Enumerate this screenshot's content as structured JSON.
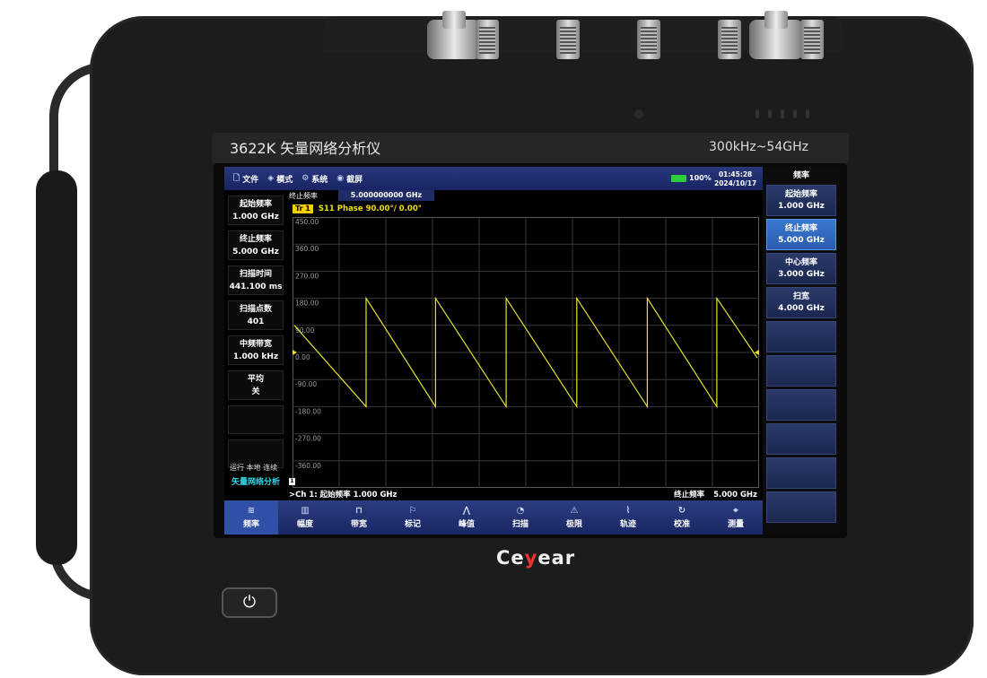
{
  "device": {
    "model": "3622K 矢量网络分析仪",
    "range": "300kHz~54GHz",
    "brand_pre": "Ce",
    "brand_slash": "y",
    "brand_post": "ear",
    "power_icon": "power-icon"
  },
  "topbar": {
    "items": [
      {
        "icon": "file-icon",
        "label": "文件"
      },
      {
        "icon": "mode-icon",
        "label": "模式"
      },
      {
        "icon": "gear-icon",
        "label": "系统"
      },
      {
        "icon": "camera-icon",
        "label": "截屏"
      }
    ],
    "battery": "100%",
    "time": "01:45:28",
    "date": "2024/10/17"
  },
  "right_panel": {
    "title": "频率",
    "buttons": [
      {
        "label": "起始频率",
        "value": "1.000 GHz",
        "active": false
      },
      {
        "label": "终止频率",
        "value": "5.000 GHz",
        "active": true
      },
      {
        "label": "中心频率",
        "value": "3.000 GHz",
        "active": false
      },
      {
        "label": "扫宽",
        "value": "4.000 GHz",
        "active": false
      }
    ]
  },
  "left_panel": {
    "buttons": [
      {
        "label": "起始频率",
        "value": "1.000 GHz"
      },
      {
        "label": "终止频率",
        "value": "5.000 GHz"
      },
      {
        "label": "扫描时间",
        "value": "441.100 ms"
      },
      {
        "label": "扫描点数",
        "value": "401"
      },
      {
        "label": "中频带宽",
        "value": "1.000 kHz"
      },
      {
        "label": "平均",
        "value": "关"
      }
    ],
    "status": "运行 本地 连续",
    "analyzer": "矢量网络分析"
  },
  "entry": {
    "label": "终止频率",
    "value": "5.000000000 GHz"
  },
  "trace": {
    "badge": "Tr 1",
    "text": "S11 Phase 90.00°/ 0.00°"
  },
  "footer": {
    "channel": ">Ch 1: 起始频率   1.000 GHz",
    "stop_label": "终止频率",
    "stop_value": "5.000 GHz",
    "ch_marker": "1"
  },
  "bottombar": [
    {
      "icon": "frequency-icon",
      "label": "频率"
    },
    {
      "icon": "amplitude-icon",
      "label": "幅度"
    },
    {
      "icon": "bandwidth-icon",
      "label": "带宽"
    },
    {
      "icon": "marker-flag-icon",
      "label": "标记"
    },
    {
      "icon": "peak-icon",
      "label": "峰值"
    },
    {
      "icon": "sweep-icon",
      "label": "扫描"
    },
    {
      "icon": "limit-warning-icon",
      "label": "极限"
    },
    {
      "icon": "trace-icon",
      "label": "轨迹"
    },
    {
      "icon": "calibration-icon",
      "label": "校准"
    },
    {
      "icon": "measure-icon",
      "label": "测量"
    }
  ],
  "chart_data": {
    "type": "line",
    "title": "S11 Phase",
    "xlabel": "",
    "ylabel": "",
    "xlim": [
      1.0,
      5.0
    ],
    "ylim": [
      -450,
      450
    ],
    "yticks": [
      450,
      360,
      270,
      180,
      90,
      0,
      -90,
      -180,
      -270,
      -360
    ],
    "ytick_labels": [
      "450.00",
      "360.00",
      "270.00",
      "180.00",
      "90.00",
      "0.00",
      "-90.00",
      "-180.00",
      "-270.00",
      "-360.00"
    ],
    "grid": true,
    "series": [
      {
        "color": "#e8e030",
        "x": [
          1.0,
          1.62,
          1.62,
          2.22,
          2.22,
          2.83,
          2.83,
          3.44,
          3.44,
          4.05,
          4.05,
          4.65,
          4.65,
          5.0
        ],
        "values": [
          90,
          -180,
          180,
          -180,
          180,
          -180,
          180,
          -180,
          180,
          -180,
          180,
          -180,
          180,
          -18
        ]
      }
    ]
  }
}
